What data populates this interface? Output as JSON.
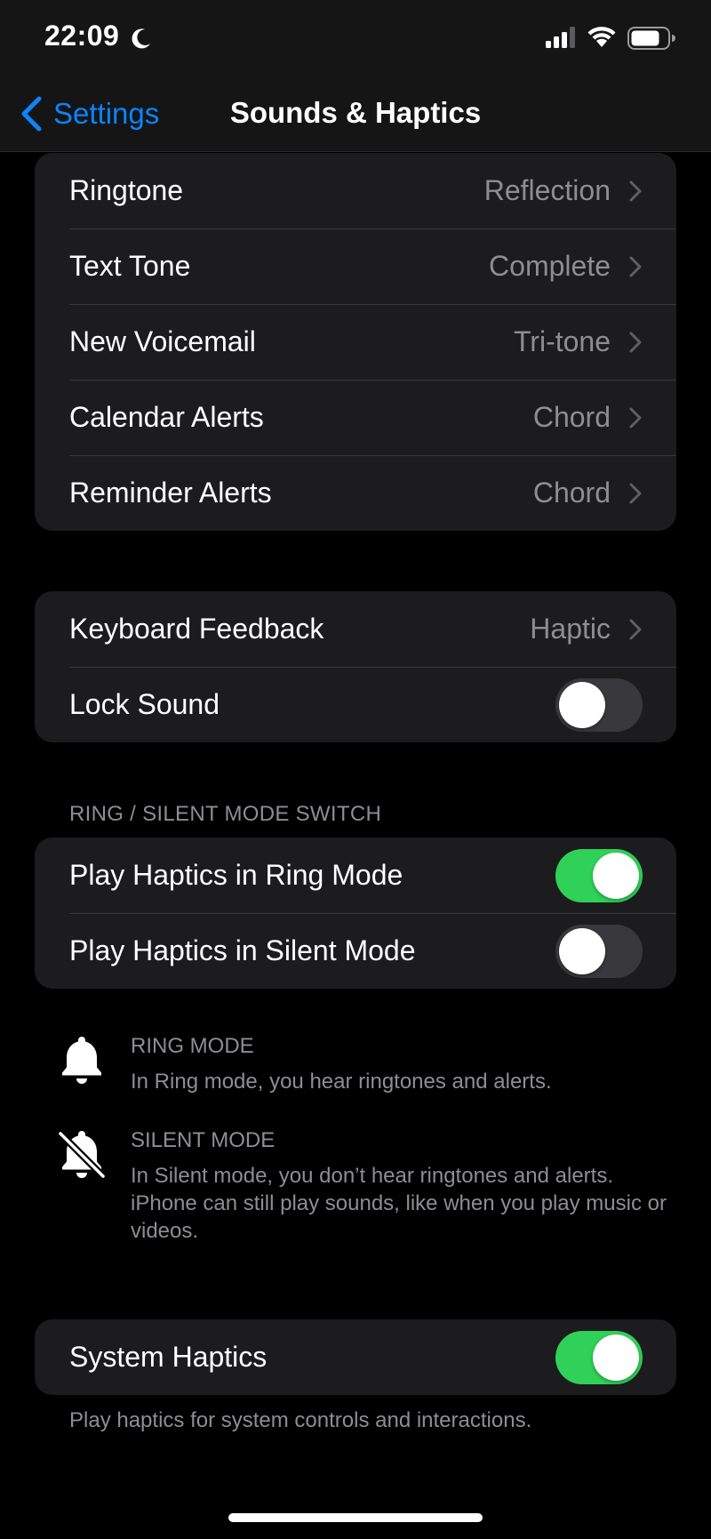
{
  "status_bar": {
    "time": "22:09"
  },
  "nav": {
    "back_label": "Settings",
    "title": "Sounds & Haptics"
  },
  "sounds_group": {
    "items": [
      {
        "label": "Ringtone",
        "value": "Reflection"
      },
      {
        "label": "Text Tone",
        "value": "Complete"
      },
      {
        "label": "New Voicemail",
        "value": "Tri-tone"
      },
      {
        "label": "Calendar Alerts",
        "value": "Chord"
      },
      {
        "label": "Reminder Alerts",
        "value": "Chord"
      }
    ]
  },
  "feedback_group": {
    "keyboard_feedback": {
      "label": "Keyboard Feedback",
      "value": "Haptic"
    },
    "lock_sound": {
      "label": "Lock Sound",
      "on": false
    }
  },
  "ring_silent": {
    "header": "RING / SILENT MODE SWITCH",
    "ring_mode_haptics": {
      "label": "Play Haptics in Ring Mode",
      "on": true
    },
    "silent_mode_haptics": {
      "label": "Play Haptics in Silent Mode",
      "on": false
    }
  },
  "mode_info": {
    "ring": {
      "icon": "bell-icon",
      "title": "RING MODE",
      "description": "In Ring mode, you hear ringtones and alerts."
    },
    "silent": {
      "icon": "bell-slash-icon",
      "title": "SILENT MODE",
      "description": "In Silent mode, you don’t hear ringtones and alerts. iPhone can still play sounds, like when you play music or videos."
    }
  },
  "system_haptics": {
    "label": "System Haptics",
    "on": true,
    "footer": "Play haptics for system controls and interactions."
  },
  "colors": {
    "accent": "#0a84ff",
    "toggle_on": "#30d158",
    "toggle_off": "#39393d",
    "cell_background": "#1c1c1e",
    "secondary_text": "#8d8d93"
  }
}
